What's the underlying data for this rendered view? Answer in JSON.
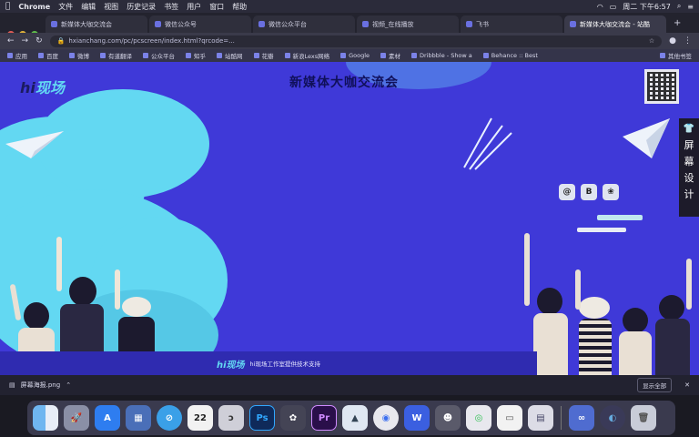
{
  "menubar": {
    "app_name": "Chrome",
    "items": [
      "文件",
      "编辑",
      "视图",
      "历史记录",
      "书签",
      "用户",
      "窗口",
      "帮助"
    ],
    "clock": "周二 下午6:57"
  },
  "tabs": [
    {
      "label": "新媒体大咖交流会"
    },
    {
      "label": "微信公众号"
    },
    {
      "label": "微信公众平台"
    },
    {
      "label": "视频_在线播放"
    },
    {
      "label": "飞书"
    },
    {
      "label": "新媒体大咖交流会 - 站酷"
    }
  ],
  "address": {
    "url": "hxianchang.com/pc/pcscreen/index.html?qrcode=..."
  },
  "bookmarks": [
    {
      "label": "应用"
    },
    {
      "label": "百度"
    },
    {
      "label": "微博"
    },
    {
      "label": "有道翻译"
    },
    {
      "label": "公众平台"
    },
    {
      "label": "知乎"
    },
    {
      "label": "站酷网"
    },
    {
      "label": "花瓣"
    },
    {
      "label": "新浪Lexs网络"
    },
    {
      "label": "Google"
    },
    {
      "label": "素材"
    },
    {
      "label": "Dribbble - Show a"
    },
    {
      "label": "Behance :: Best"
    },
    {
      "label": "其他书签"
    }
  ],
  "content": {
    "title": "新媒体大咖交流会",
    "logo_text_a": "hi",
    "logo_text_b": "现场",
    "side_tab_icon": "shirt-icon",
    "side_tab_chars": [
      "屏",
      "幕",
      "设",
      "计"
    ],
    "social_icons": [
      "@",
      "B",
      "❀"
    ],
    "footer_logo": "hi现场",
    "footer_text": "hi现场工作室提供技术支持"
  },
  "download": {
    "filename": "屏幕海报.png",
    "show_all": "显示全部"
  },
  "dock": {
    "icons": [
      "Finder",
      "Launchpad",
      "App Store",
      "Preview",
      "Safari",
      "Calendar",
      "Siri",
      "Ps",
      "Ai",
      "Pr",
      "Keynote",
      "Chrome",
      "WPS",
      "WeChat",
      "Notes",
      "Finder2",
      "Baidu",
      "Mail",
      "Trash"
    ],
    "calendar_day": "22",
    "ps_label": "Ps",
    "pr_label": "Pr",
    "wps_label": "W"
  },
  "colors": {
    "background_blue": "#3f39d8",
    "cloud_cyan": "#63d8f2",
    "menubar": "#2b2b3a"
  }
}
